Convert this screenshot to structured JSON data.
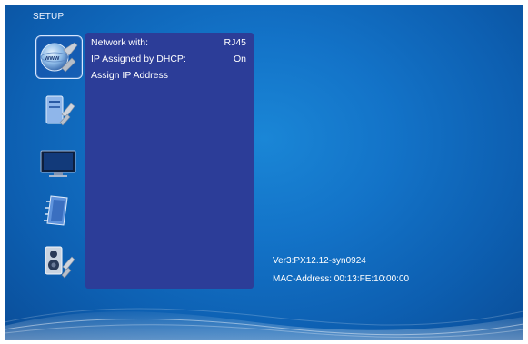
{
  "screen": {
    "title": "SETUP"
  },
  "sidebar": {
    "items": [
      {
        "icon": "network-setup-icon",
        "selected": true
      },
      {
        "icon": "system-setup-icon",
        "selected": false
      },
      {
        "icon": "display-setup-icon",
        "selected": false
      },
      {
        "icon": "preferences-setup-icon",
        "selected": false
      },
      {
        "icon": "audio-setup-icon",
        "selected": false
      }
    ]
  },
  "network_panel": {
    "rows": [
      {
        "label": "Network with:",
        "value": "RJ45"
      },
      {
        "label": "IP Assigned by DHCP:",
        "value": "On"
      },
      {
        "label": "Assign IP Address",
        "value": ""
      }
    ]
  },
  "info": {
    "version": "Ver3:PX12.12-syn0924",
    "mac_address": "MAC-Address: 00:13:FE:10:00:00"
  },
  "colors": {
    "background": "#1373c8",
    "panel": "#2c3d98",
    "text": "#ffffff"
  }
}
